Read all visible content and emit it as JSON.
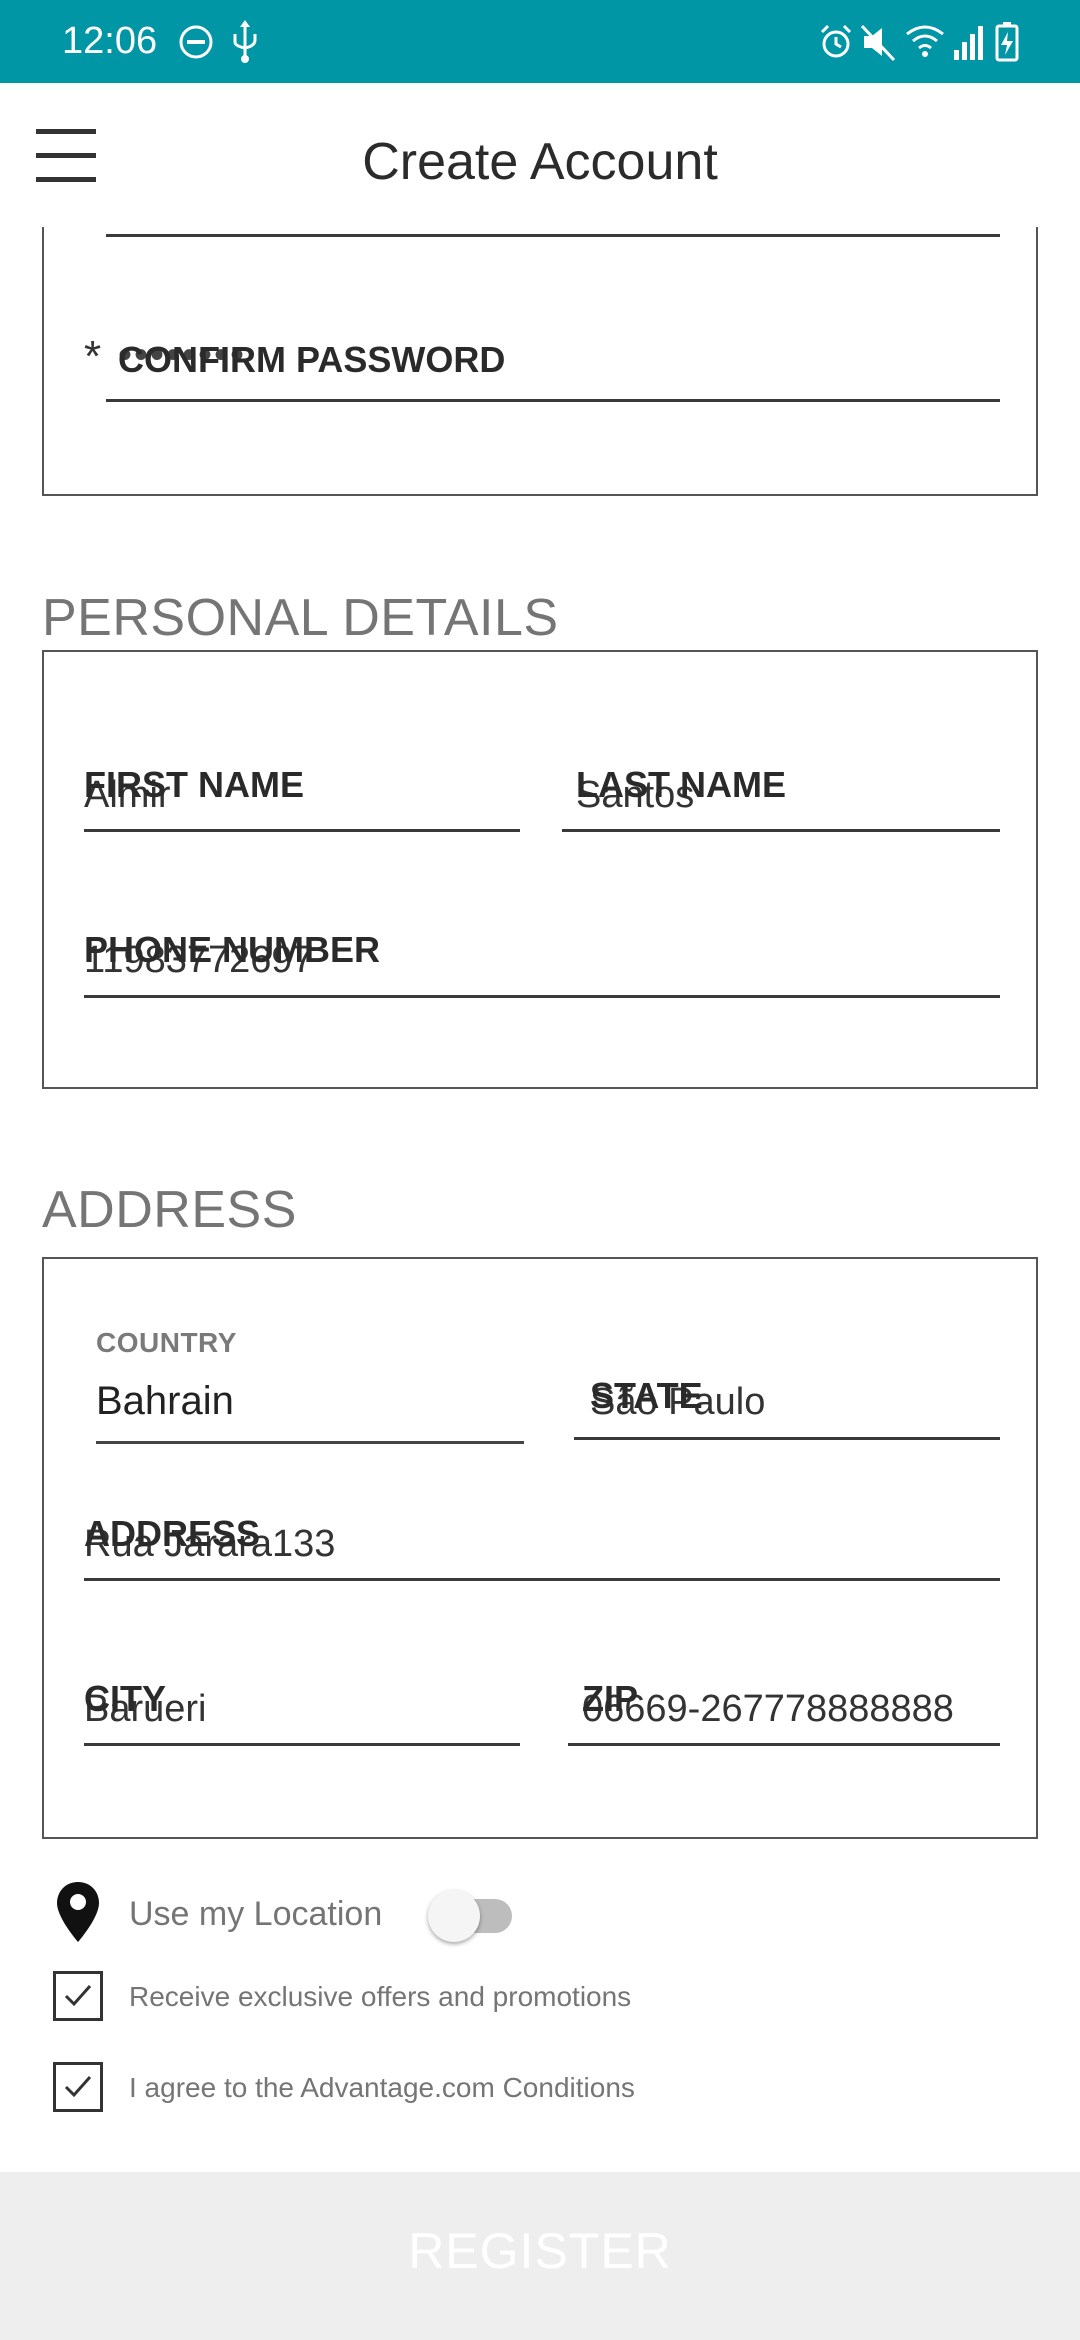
{
  "status_bar": {
    "time": "12:06",
    "background": "#0096a6",
    "icons": [
      "do-not-disturb-icon",
      "usb-icon",
      "alarm-icon",
      "mute-icon",
      "wifi-icon",
      "signal-icon",
      "battery-charging-icon"
    ]
  },
  "app_bar": {
    "title": "Create Account",
    "menu_icon": "hamburger-menu-icon"
  },
  "account": {
    "confirm_password_required_mark": "*",
    "confirm_password_label": "CONFIRM PASSWORD",
    "confirm_password_dots": "••••••••"
  },
  "personal_details": {
    "title": "PERSONAL DETAILS",
    "first_name_label": "FIRST NAME",
    "first_name_value": "Almir",
    "last_name_label": "LAST NAME",
    "last_name_value": "Santos",
    "phone_label": "PHONE NUMBER",
    "phone_value": "11983772697"
  },
  "address": {
    "title": "ADDRESS",
    "country_label": "COUNTRY",
    "country_value": "Bahrain",
    "state_label": "STATE",
    "state_value": "São Paulo",
    "address_label": "ADDRESS",
    "address_value": "Rua Jarara133",
    "city_label": "CITY",
    "city_value": "Barueri",
    "zip_label": "ZIP",
    "zip_value": "06669-267778888888"
  },
  "options": {
    "location_icon": "location-pin-icon",
    "use_location_label": "Use my Location",
    "use_location_enabled": false,
    "offers_label": "Receive exclusive offers and promotions",
    "offers_checked": true,
    "conditions_label": "I agree to the Advantage.com Conditions",
    "conditions_checked": true
  },
  "register_button": {
    "label": "REGISTER"
  }
}
